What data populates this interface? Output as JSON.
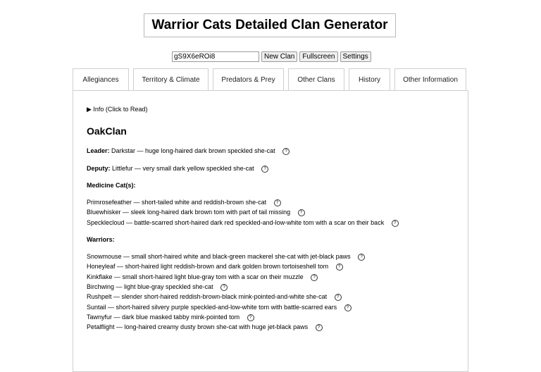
{
  "title": "Warrior Cats Detailed Clan Generator",
  "seed": "gS9X6eROi8",
  "buttons": {
    "new_clan": "New Clan",
    "fullscreen": "Fullscreen",
    "settings": "Settings"
  },
  "tabs": [
    "Allegiances",
    "Territory & Climate",
    "Predators & Prey",
    "Other Clans",
    "History",
    "Other Information"
  ],
  "info_toggle": "▶ Info (Click to Read)",
  "clan_name": "OakClan",
  "leader": {
    "label": "Leader:",
    "text": "Darkstar — huge long-haired dark brown speckled she-cat"
  },
  "deputy": {
    "label": "Deputy:",
    "text": "Littlefur — very small dark yellow speckled she-cat"
  },
  "medicine_heading": "Medicine Cat(s):",
  "medicine": [
    "Primrosefeather — short-tailed white and reddish-brown she-cat",
    "Bluewhisker — sleek long-haired dark brown tom with part of tail missing",
    "Specklecloud — battle-scarred short-haired dark red speckled-and-low-white tom with a scar on their back"
  ],
  "warriors_heading": "Warriors:",
  "warriors": [
    "Snowmouse — small short-haired white and black-green mackerel she-cat with jet-black paws",
    "Honeyleaf — short-haired light reddish-brown and dark golden brown tortoiseshell tom",
    "Kinkflake — small short-haired light blue-gray tom with a scar on their muzzle",
    "Birchwing — light blue-gray speckled she-cat",
    "Rushpelt — slender short-haired reddish-brown-black mink-pointed-and-white she-cat",
    "Suntail — short-haired silvery purple speckled-and-low-white tom with battle-scarred ears",
    "Tawnyfur — dark blue masked tabby mink-pointed tom",
    "Petalflight — long-haired creamy dusty brown she-cat with huge jet-black paws"
  ]
}
